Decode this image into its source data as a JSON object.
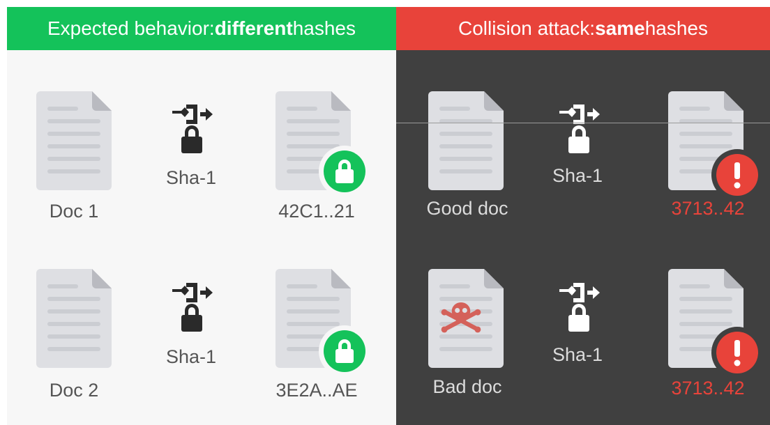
{
  "left": {
    "header_prefix": "Expected behavior: ",
    "header_bold": "different",
    "header_suffix": " hashes",
    "rows": [
      {
        "doc_name": "Doc 1",
        "algo": "Sha-1",
        "hash": "42C1..21"
      },
      {
        "doc_name": "Doc 2",
        "algo": "Sha-1",
        "hash": "3E2A..AE"
      }
    ]
  },
  "right": {
    "header_prefix": "Collision attack: ",
    "header_bold": "same",
    "header_suffix": " hashes",
    "rows": [
      {
        "doc_name": "Good doc",
        "algo": "Sha-1",
        "hash": "3713..42"
      },
      {
        "doc_name": "Bad doc",
        "algo": "Sha-1",
        "hash": "3713..42"
      }
    ]
  },
  "colors": {
    "expected_green": "#14c25a",
    "attack_red": "#e8433a",
    "dark_bg": "#404040",
    "light_bg": "#f7f7f7"
  },
  "icons": {
    "document": "document-icon",
    "hash": "hash-function-icon",
    "lock_badge": "lock-badge-icon",
    "warning_badge": "exclamation-badge-icon",
    "skull": "skull-crossbones-icon"
  }
}
